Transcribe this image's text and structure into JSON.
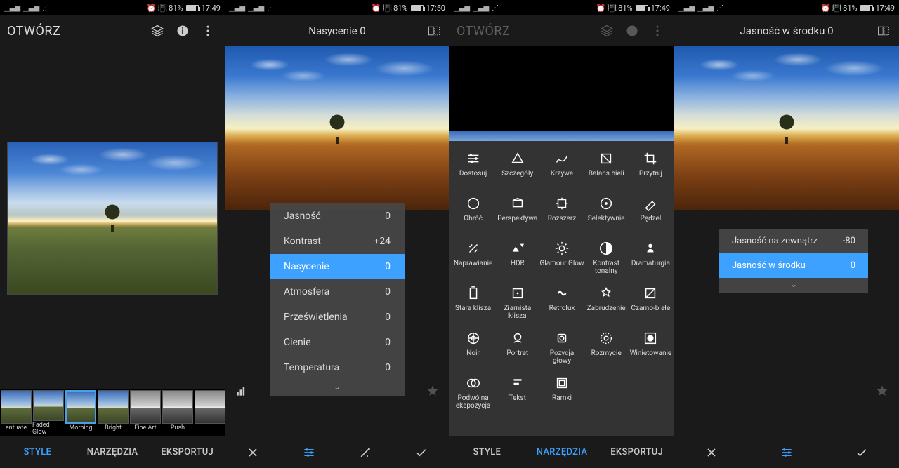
{
  "status": {
    "battery": "81%",
    "time1": "17:49",
    "time2": "17:50"
  },
  "p1": {
    "open": "OTWÓRZ",
    "styles": [
      "entuate",
      "Faded Glow",
      "Morning",
      "Bright",
      "Fine Art",
      "Push",
      ""
    ],
    "tabs": {
      "style": "STYLE",
      "tools": "NARZĘDZIA",
      "export": "EKSPORTUJ"
    }
  },
  "p2": {
    "title": "Nasycenie 0",
    "sliders": [
      {
        "label": "Jasność",
        "value": "0"
      },
      {
        "label": "Kontrast",
        "value": "+24"
      },
      {
        "label": "Nasycenie",
        "value": "0",
        "sel": true
      },
      {
        "label": "Atmosfera",
        "value": "0"
      },
      {
        "label": "Prześwietlenia",
        "value": "0"
      },
      {
        "label": "Cienie",
        "value": "0"
      },
      {
        "label": "Temperatura",
        "value": "0"
      }
    ]
  },
  "p3": {
    "open": "OTWÓRZ",
    "tools": [
      "Dostosuj",
      "Szczegóły",
      "Krzywe",
      "Balans bieli",
      "Przytnij",
      "Obróć",
      "Perspektywa",
      "Rozszerz",
      "Selektywnie",
      "Pędzel",
      "Naprawianie",
      "HDR",
      "Glamour Glow",
      "Kontrast tonalny",
      "Dramaturgia",
      "Stara klisza",
      "Ziarnista klisza",
      "Retrolux",
      "Zabrudzenie",
      "Czarno-białe",
      "Noir",
      "Portret",
      "Pozycja głowy",
      "Rozmycie",
      "Winietowanie",
      "Podwójna ekspozycja",
      "Tekst",
      "Ramki"
    ],
    "tabs": {
      "style": "STYLE",
      "tools": "NARZĘDZIA",
      "export": "EKSPORTUJ"
    }
  },
  "p4": {
    "title": "Jasność w środku 0",
    "rows": [
      {
        "label": "Jasność na zewnątrz",
        "value": "-80"
      },
      {
        "label": "Jasność w środku",
        "value": "0",
        "sel": true
      }
    ]
  }
}
